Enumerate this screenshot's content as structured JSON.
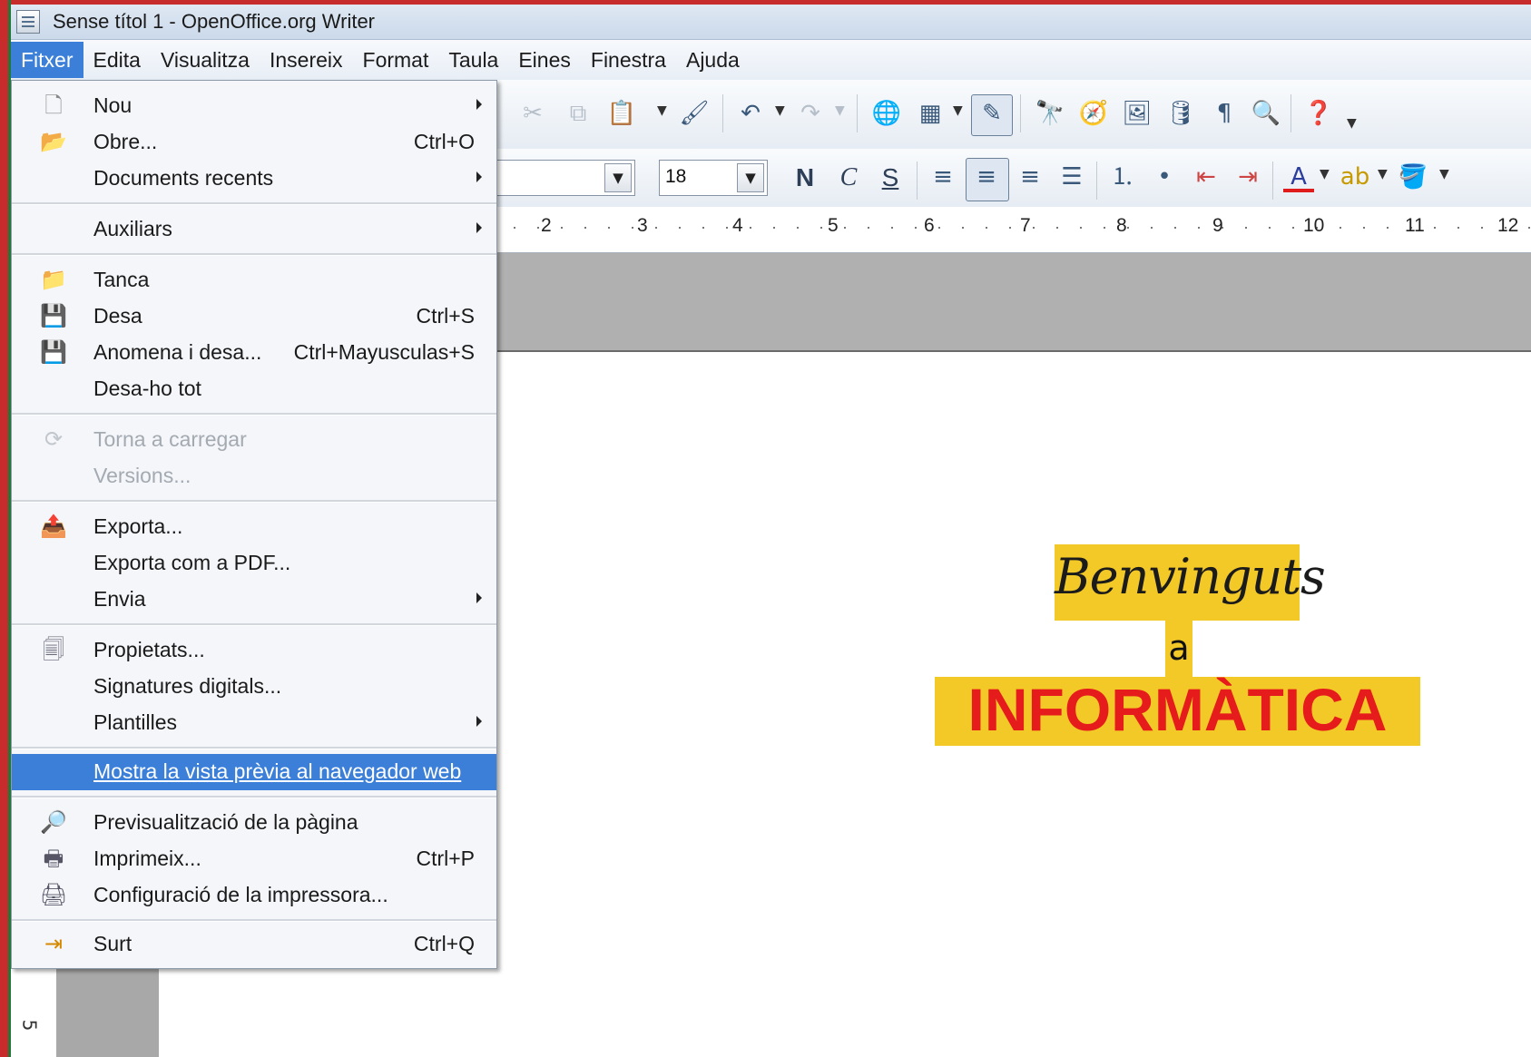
{
  "window": {
    "title": "Sense títol 1 - OpenOffice.org Writer"
  },
  "menubar": {
    "items": [
      "Fitxer",
      "Edita",
      "Visualitza",
      "Insereix",
      "Format",
      "Taula",
      "Eines",
      "Finestra",
      "Ajuda"
    ],
    "active": "Fitxer"
  },
  "toolbar": {
    "font_size": "18",
    "bold_label": "N",
    "italic_label": "C",
    "underline_label": "S"
  },
  "ruler": {
    "numbers": [
      "2",
      "3",
      "4",
      "5",
      "6",
      "7",
      "8",
      "9",
      "10",
      "11",
      "12"
    ]
  },
  "vruler": {
    "number": "5"
  },
  "file_menu": {
    "items": [
      {
        "label": "Nou",
        "shortcut": "",
        "submenu": true,
        "icon": "new-document-icon"
      },
      {
        "label": "Obre...",
        "shortcut": "Ctrl+O",
        "submenu": false,
        "icon": "open-folder-icon"
      },
      {
        "label": "Documents recents",
        "shortcut": "",
        "submenu": true,
        "icon": ""
      },
      {
        "label": "Auxiliars",
        "shortcut": "",
        "submenu": true,
        "icon": ""
      },
      {
        "label": "Tanca",
        "shortcut": "",
        "submenu": false,
        "icon": "close-document-icon"
      },
      {
        "label": "Desa",
        "shortcut": "Ctrl+S",
        "submenu": false,
        "icon": "save-icon"
      },
      {
        "label": "Anomena i desa...",
        "shortcut": "Ctrl+Mayusculas+S",
        "submenu": false,
        "icon": "save-as-icon"
      },
      {
        "label": "Desa-ho tot",
        "shortcut": "",
        "submenu": false,
        "icon": ""
      },
      {
        "label": "Torna a carregar",
        "shortcut": "",
        "submenu": false,
        "icon": "reload-icon",
        "disabled": true
      },
      {
        "label": "Versions...",
        "shortcut": "",
        "submenu": false,
        "icon": "",
        "disabled": true
      },
      {
        "label": "Exporta...",
        "shortcut": "",
        "submenu": false,
        "icon": "export-icon"
      },
      {
        "label": "Exporta com a PDF...",
        "shortcut": "",
        "submenu": false,
        "icon": ""
      },
      {
        "label": "Envia",
        "shortcut": "",
        "submenu": true,
        "icon": ""
      },
      {
        "label": "Propietats...",
        "shortcut": "",
        "submenu": false,
        "icon": "properties-icon"
      },
      {
        "label": "Signatures digitals...",
        "shortcut": "",
        "submenu": false,
        "icon": ""
      },
      {
        "label": "Plantilles",
        "shortcut": "",
        "submenu": true,
        "icon": ""
      },
      {
        "label": "Mostra la vista prèvia al navegador web",
        "shortcut": "",
        "submenu": false,
        "icon": "",
        "highlighted": true
      },
      {
        "label": "Previsualització de la pàgina",
        "shortcut": "",
        "submenu": false,
        "icon": "page-preview-icon"
      },
      {
        "label": "Imprimeix...",
        "shortcut": "Ctrl+P",
        "submenu": false,
        "icon": "printer-icon"
      },
      {
        "label": "Configuració de la impressora...",
        "shortcut": "",
        "submenu": false,
        "icon": "printer-settings-icon"
      },
      {
        "label": "Surt",
        "shortcut": "Ctrl+Q",
        "submenu": false,
        "icon": "exit-icon"
      }
    ]
  },
  "document": {
    "line1": "Benvinguts",
    "line2": "a",
    "line3": "INFORMÀTICA"
  },
  "colors": {
    "highlight_yellow": "#f3c928",
    "title_red": "#e61b1b",
    "menu_selection": "#3b7fd8"
  }
}
